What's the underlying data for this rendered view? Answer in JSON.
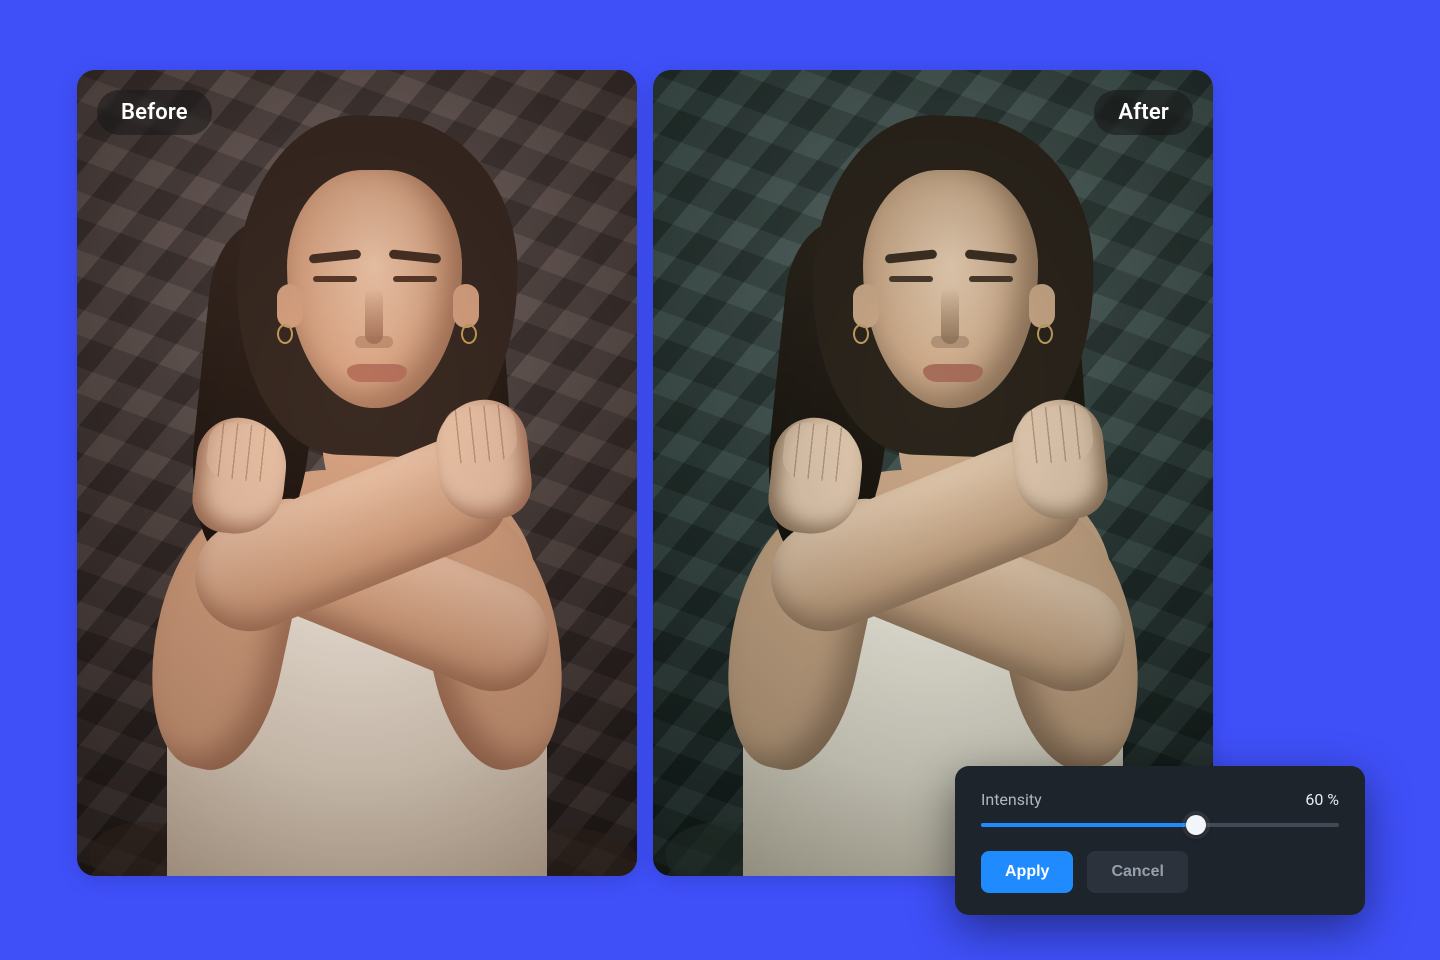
{
  "compare": {
    "before_label": "Before",
    "after_label": "After"
  },
  "controls": {
    "slider_label": "Intensity",
    "slider_value_display": "60 %",
    "slider_percent": 60,
    "apply_label": "Apply",
    "cancel_label": "Cancel"
  },
  "colors": {
    "page_bg": "#3f50f9",
    "card_bg": "#1e242c",
    "accent": "#1f8bff"
  }
}
